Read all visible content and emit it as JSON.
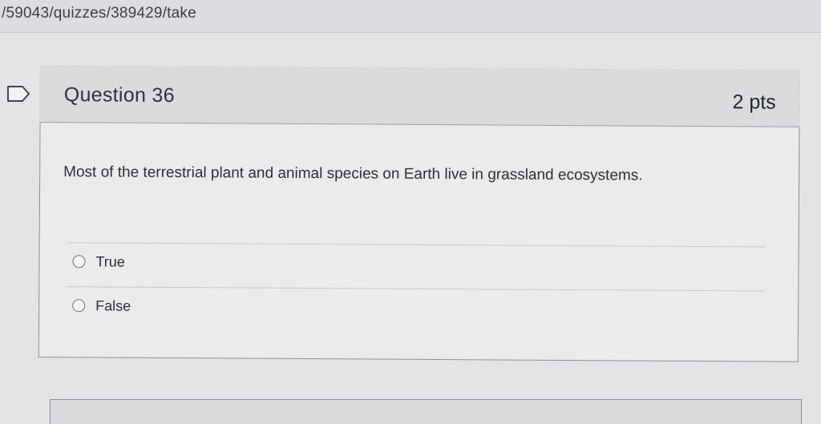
{
  "browser": {
    "url_fragment": "/59043/quizzes/389429/take"
  },
  "question": {
    "title": "Question 36",
    "points": "2 pts",
    "text": "Most of the terrestrial plant and animal species on Earth live in grassland ecosystems.",
    "flag_icon": "flag-bookmark-icon"
  },
  "answers": [
    {
      "label": "True",
      "selected": false
    },
    {
      "label": "False",
      "selected": false
    }
  ],
  "colors": {
    "page_background": "#e3e4e6",
    "header_background": "#dadbdd",
    "border": "#8b9096",
    "text": "#2d3b45"
  }
}
